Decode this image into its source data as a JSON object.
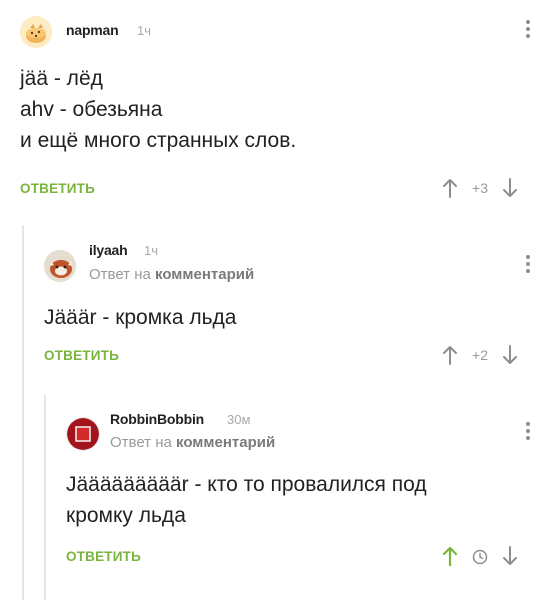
{
  "comments": [
    {
      "author": "napman",
      "time": "1ч",
      "text": "jää - лёд\nahv - обезьяна\nи ещё много странных слов.",
      "reply_label": "ОТВЕТИТЬ",
      "rating": "+3",
      "avatar_icon": "cookie-cat-avatar"
    },
    {
      "author": "ilyaah",
      "time": "1ч",
      "reply_prefix": "Ответ на",
      "reply_target": "комментарий",
      "text": "Jääär  - кромка льда",
      "reply_label": "ОТВЕТИТЬ",
      "rating": "+2",
      "avatar_icon": "red-panda-avatar"
    },
    {
      "author": "RobbinBobbin",
      "time": "30м",
      "reply_prefix": "Ответ на",
      "reply_target": "комментарий",
      "text": "Jääääääääär - кто то провалился под\nкромку льда",
      "reply_label": "ОТВЕТИТЬ",
      "rating_icon": "clock-icon",
      "avatar_icon": "red-square-avatar"
    }
  ],
  "colors": {
    "accent_green": "#79b43c",
    "muted_text": "#9a9a9a",
    "thread_line": "#e6e6e6"
  }
}
